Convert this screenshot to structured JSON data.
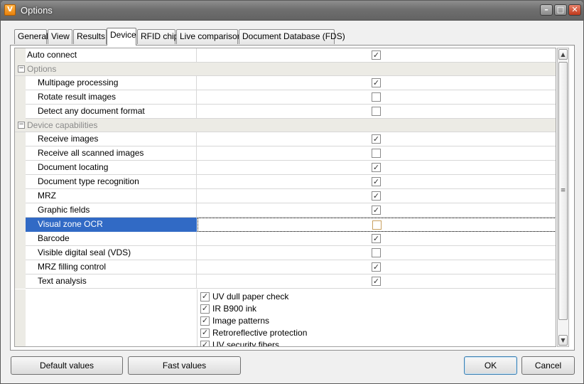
{
  "window": {
    "title": "Options",
    "icon_glyph": "V",
    "controls": {
      "minimize": "–",
      "maximize": "□",
      "close": "✕"
    }
  },
  "tabs": [
    {
      "label": "General",
      "active": false
    },
    {
      "label": "View",
      "active": false
    },
    {
      "label": "Results",
      "active": false
    },
    {
      "label": "Device",
      "active": true
    },
    {
      "label": "RFID chip",
      "active": false
    },
    {
      "label": "Live comparison",
      "active": false
    },
    {
      "label": "Document Database (FDS)",
      "active": false
    }
  ],
  "grid": {
    "top_rows": [
      {
        "label": "Auto connect",
        "checked": true
      }
    ],
    "categories": [
      {
        "label": "Options",
        "toggle": "−",
        "rows": [
          {
            "label": "Multipage processing",
            "checked": true
          },
          {
            "label": "Rotate result images",
            "checked": false
          },
          {
            "label": "Detect any document format",
            "checked": false
          }
        ]
      },
      {
        "label": "Device capabilities",
        "toggle": "−",
        "rows": [
          {
            "label": "Receive images",
            "checked": true
          },
          {
            "label": "Receive all scanned images",
            "checked": false
          },
          {
            "label": "Document locating",
            "checked": true
          },
          {
            "label": "Document type recognition",
            "checked": true
          },
          {
            "label": "MRZ",
            "checked": true
          },
          {
            "label": "Graphic fields",
            "checked": true
          },
          {
            "label": "Visual zone OCR",
            "checked": false,
            "selected": true
          },
          {
            "label": "Barcode",
            "checked": true
          },
          {
            "label": "Visible digital seal (VDS)",
            "checked": false
          },
          {
            "label": "MRZ filling control",
            "checked": true
          },
          {
            "label": "Text analysis",
            "checked": true
          }
        ]
      }
    ],
    "text_analysis_checks": [
      {
        "label": "UV dull paper check",
        "checked": true
      },
      {
        "label": "IR B900 ink",
        "checked": true
      },
      {
        "label": "Image patterns",
        "checked": true
      },
      {
        "label": "Retroreflective protection",
        "checked": true
      },
      {
        "label": "UV security fibers",
        "checked": true
      }
    ],
    "check_glyph": "✓"
  },
  "scrollbar": {
    "up": "▲",
    "down": "▼",
    "grip": "≡"
  },
  "buttons": {
    "default_values": "Default values",
    "fast_values": "Fast values",
    "ok": "OK",
    "cancel": "Cancel"
  },
  "colors": {
    "selection": "#316ac5",
    "category_background": "#ecebe5",
    "category_text": "#8a8a8a"
  },
  "icons": {
    "app": "app-logo-icon",
    "minimize": "minimize-icon",
    "maximize": "maximize-icon",
    "close": "close-icon",
    "collapse": "collapse-icon",
    "checkbox": "checkbox-icon",
    "scroll_up": "arrow-up-icon",
    "scroll_down": "arrow-down-icon"
  }
}
